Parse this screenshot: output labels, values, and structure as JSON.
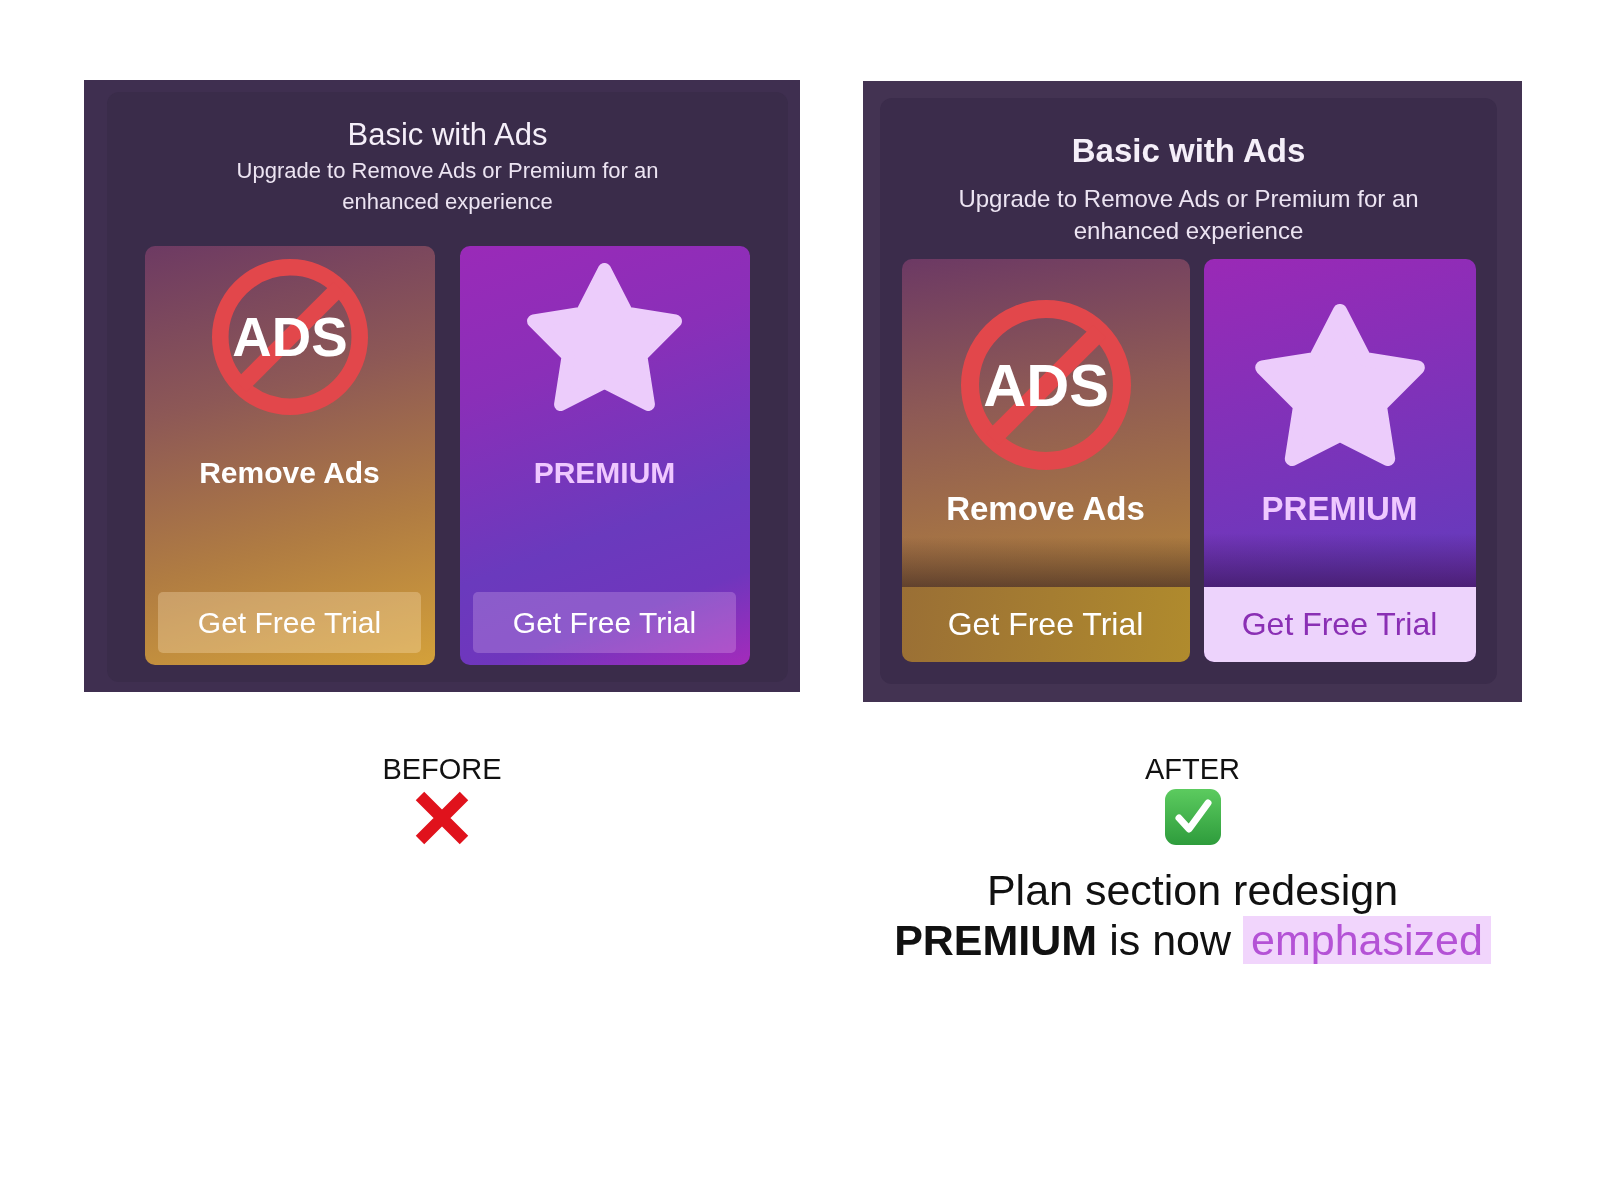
{
  "comparisons": [
    {
      "kind": "before",
      "plan_section": {
        "title": "Basic with Ads",
        "subtitle": "Upgrade to Remove Ads or Premium for an enhanced experience",
        "plans": [
          {
            "kind": "remove_ads",
            "icon_text": "ADS",
            "name": "Remove Ads",
            "button": "Get Free Trial"
          },
          {
            "kind": "premium",
            "name": "PREMIUM",
            "button": "Get Free Trial"
          }
        ]
      },
      "label": "BEFORE"
    },
    {
      "kind": "after",
      "plan_section": {
        "title": "Basic with Ads",
        "subtitle": "Upgrade to Remove Ads or Premium for an enhanced experience",
        "plans": [
          {
            "kind": "remove_ads",
            "icon_text": "ADS",
            "name": "Remove Ads",
            "button": "Get Free Trial"
          },
          {
            "kind": "premium",
            "name": "PREMIUM",
            "button": "Get Free Trial"
          }
        ]
      },
      "label": "AFTER",
      "caption": {
        "heading": "Plan section redesign",
        "text": "**PREMIUM** is now",
        "highlight": "emphasized"
      }
    }
  ]
}
